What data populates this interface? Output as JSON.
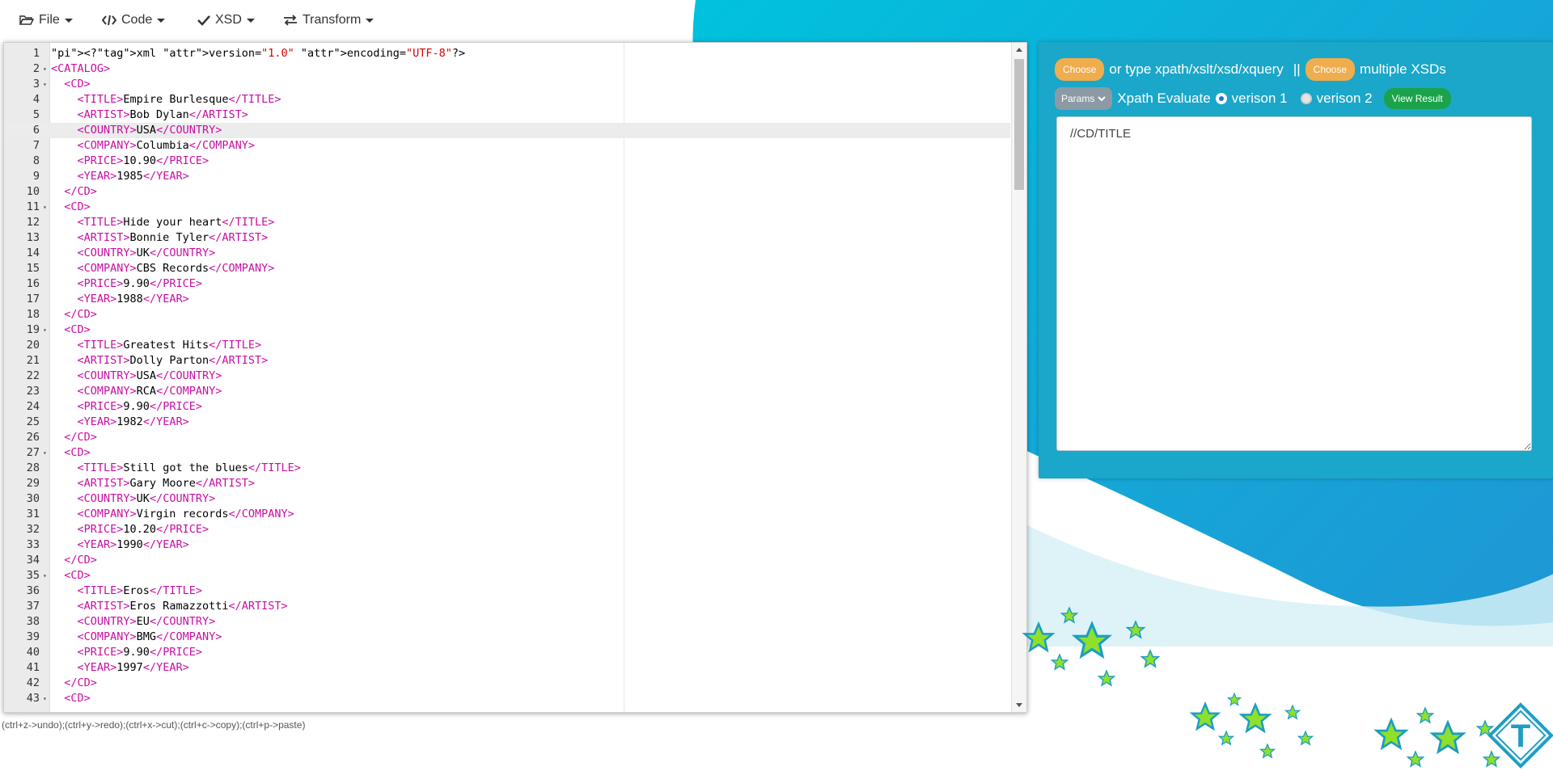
{
  "menu": {
    "file": "File",
    "code": "Code",
    "xsd": "XSD",
    "transform": "Transform"
  },
  "editor": {
    "active_line": 6,
    "lines": [
      {
        "n": "1",
        "fold": false
      },
      {
        "n": "2",
        "fold": true
      },
      {
        "n": "3",
        "fold": true
      },
      {
        "n": "4",
        "fold": false
      },
      {
        "n": "5",
        "fold": false
      },
      {
        "n": "6",
        "fold": false
      },
      {
        "n": "7",
        "fold": false
      },
      {
        "n": "8",
        "fold": false
      },
      {
        "n": "9",
        "fold": false
      },
      {
        "n": "10",
        "fold": false
      },
      {
        "n": "11",
        "fold": true
      },
      {
        "n": "12",
        "fold": false
      },
      {
        "n": "13",
        "fold": false
      },
      {
        "n": "14",
        "fold": false
      },
      {
        "n": "15",
        "fold": false
      },
      {
        "n": "16",
        "fold": false
      },
      {
        "n": "17",
        "fold": false
      },
      {
        "n": "18",
        "fold": false
      },
      {
        "n": "19",
        "fold": true
      },
      {
        "n": "20",
        "fold": false
      },
      {
        "n": "21",
        "fold": false
      },
      {
        "n": "22",
        "fold": false
      },
      {
        "n": "23",
        "fold": false
      },
      {
        "n": "24",
        "fold": false
      },
      {
        "n": "25",
        "fold": false
      },
      {
        "n": "26",
        "fold": false
      },
      {
        "n": "27",
        "fold": true
      },
      {
        "n": "28",
        "fold": false
      },
      {
        "n": "29",
        "fold": false
      },
      {
        "n": "30",
        "fold": false
      },
      {
        "n": "31",
        "fold": false
      },
      {
        "n": "32",
        "fold": false
      },
      {
        "n": "33",
        "fold": false
      },
      {
        "n": "34",
        "fold": false
      },
      {
        "n": "35",
        "fold": true
      },
      {
        "n": "36",
        "fold": false
      },
      {
        "n": "37",
        "fold": false
      },
      {
        "n": "38",
        "fold": false
      },
      {
        "n": "39",
        "fold": false
      },
      {
        "n": "40",
        "fold": false
      },
      {
        "n": "41",
        "fold": false
      },
      {
        "n": "42",
        "fold": false
      },
      {
        "n": "43",
        "fold": true
      }
    ],
    "code": [
      "<?xml version=\"1.0\" encoding=\"UTF-8\"?>",
      "<CATALOG>",
      "  <CD>",
      "    <TITLE>Empire Burlesque</TITLE>",
      "    <ARTIST>Bob Dylan</ARTIST>",
      "    <COUNTRY>USA</COUNTRY>",
      "    <COMPANY>Columbia</COMPANY>",
      "    <PRICE>10.90</PRICE>",
      "    <YEAR>1985</YEAR>",
      "  </CD>",
      "  <CD>",
      "    <TITLE>Hide your heart</TITLE>",
      "    <ARTIST>Bonnie Tyler</ARTIST>",
      "    <COUNTRY>UK</COUNTRY>",
      "    <COMPANY>CBS Records</COMPANY>",
      "    <PRICE>9.90</PRICE>",
      "    <YEAR>1988</YEAR>",
      "  </CD>",
      "  <CD>",
      "    <TITLE>Greatest Hits</TITLE>",
      "    <ARTIST>Dolly Parton</ARTIST>",
      "    <COUNTRY>USA</COUNTRY>",
      "    <COMPANY>RCA</COMPANY>",
      "    <PRICE>9.90</PRICE>",
      "    <YEAR>1982</YEAR>",
      "  </CD>",
      "  <CD>",
      "    <TITLE>Still got the blues</TITLE>",
      "    <ARTIST>Gary Moore</ARTIST>",
      "    <COUNTRY>UK</COUNTRY>",
      "    <COMPANY>Virgin records</COMPANY>",
      "    <PRICE>10.20</PRICE>",
      "    <YEAR>1990</YEAR>",
      "  </CD>",
      "  <CD>",
      "    <TITLE>Eros</TITLE>",
      "    <ARTIST>Eros Ramazzotti</ARTIST>",
      "    <COUNTRY>EU</COUNTRY>",
      "    <COMPANY>BMG</COMPANY>",
      "    <PRICE>9.90</PRICE>",
      "    <YEAR>1997</YEAR>",
      "  </CD>",
      "  <CD>"
    ]
  },
  "shortcuts": "(ctrl+z->undo);(ctrl+y->redo);(ctrl+x->cut);(ctrl+c->copy);(ctrl+p->paste)",
  "panel": {
    "choose1": "Choose",
    "type_text": "or type xpath/xslt/xsd/xquery",
    "separator": "||",
    "choose2": "Choose",
    "multiple_text": "multiple XSDs",
    "params_label": "Params",
    "xpath_label": "Xpath Evaluate",
    "version1_label": "verison 1",
    "version2_label": "verison 2",
    "view_result": "View Result",
    "query_value": "//CD/TITLE"
  },
  "colors": {
    "tag": "#c70fa3",
    "attr": "#3a3ad6",
    "string": "#d40000",
    "panel": "#1aa7c9",
    "btn_orange": "#f0ad4e",
    "btn_green": "#1aa34a",
    "star": "#7ed321"
  },
  "icons": {
    "file": "folder-open-icon",
    "code": "code-icon",
    "xsd": "check-icon",
    "transform": "exchange-icon"
  },
  "logo": {
    "letter": "T"
  }
}
